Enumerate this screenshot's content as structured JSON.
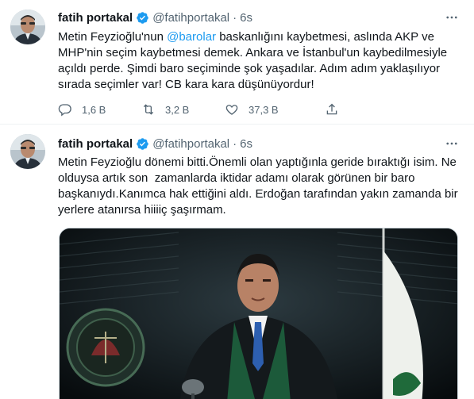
{
  "colors": {
    "accent": "#1d9bf0",
    "text": "#0f1419",
    "muted": "#536471",
    "border": "#eff3f4"
  },
  "tweets": [
    {
      "name": "fatih portakal",
      "handle": "@fatihportakal",
      "dot": "·",
      "time": "6s",
      "text_before": "Metin Feyzioğlu'nun ",
      "mention": "@barolar",
      "text_after": " baskanlığını kaybetmesi, aslında AKP ve MHP'nin seçim kaybetmesi demek. Ankara ve İstanbul'un kaybedilmesiyle açıldı perde. Şimdi baro seçiminde şok yaşadılar. Adım adım yaklaşılıyor sırada seçimler var! CB kara kara düşünüyordur!",
      "replies": "1,6 B",
      "retweets": "3,2 B",
      "likes": "37,3 B",
      "icons": [
        "verified-badge-icon",
        "more-icon",
        "reply-icon",
        "retweet-icon",
        "like-icon",
        "share-icon"
      ]
    },
    {
      "name": "fatih portakal",
      "handle": "@fatihportakal",
      "dot": "·",
      "time": "6s",
      "text": "Metin Feyzioğlu dönemi bitti.Önemli olan yaptığınla geride bıraktığı isim. Ne olduysa artık son  zamanlarda iktidar adamı olarak görünen bir baro başkanıydı.Kanımca hak ettiğini aldı. Erdoğan tarafından yakın zamanda bir yerlere atanırsa hiiiiç şaşırmam.",
      "icons": [
        "verified-badge-icon",
        "more-icon"
      ]
    }
  ]
}
